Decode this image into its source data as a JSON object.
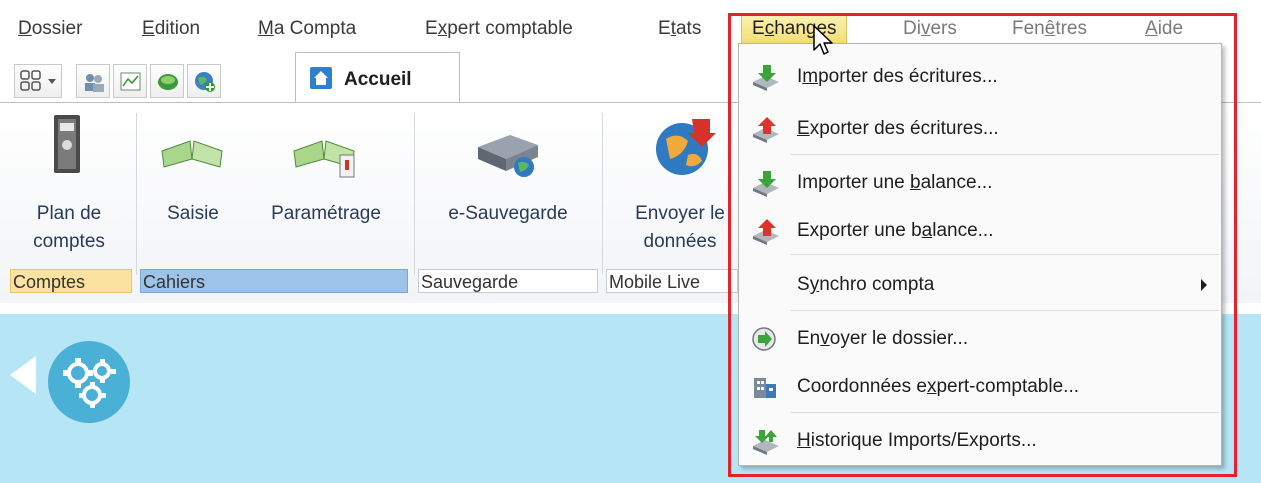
{
  "menubar": {
    "items": [
      {
        "label": "Dossier",
        "mnemonic": "D",
        "rest": "ossier"
      },
      {
        "label": "Edition",
        "mnemonic": "E",
        "rest": "dition"
      },
      {
        "label": "Ma Compta",
        "pre": "",
        "mnemonic": "M",
        "rest": "a Compta"
      },
      {
        "label": "Expert comptable",
        "pre": "E",
        "mnemonic": "x",
        "rest": "pert comptable"
      },
      {
        "label": "Etats",
        "pre": "E",
        "mnemonic": "t",
        "rest": "ats"
      },
      {
        "label": "Echanges",
        "pre": "E",
        "mnemonic": "c",
        "rest": "hanges"
      },
      {
        "label": "Divers",
        "pre": "Di",
        "mnemonic": "v",
        "rest": "ers"
      },
      {
        "label": "Fenêtres",
        "pre": "Fen",
        "mnemonic": "ê",
        "rest": "tres"
      },
      {
        "label": "Aide",
        "pre": "",
        "mnemonic": "A",
        "rest": "ide"
      }
    ]
  },
  "tabs": {
    "accueil": "Accueil"
  },
  "ribbon": {
    "buttons": {
      "plan_comptes_l1": "Plan de",
      "plan_comptes_l2": "comptes",
      "saisie": "Saisie",
      "parametrage": "Paramétrage",
      "e_sauvegarde": "e-Sauvegarde",
      "envoyer_l1": "Envoyer le",
      "envoyer_l2": "données"
    },
    "groups": {
      "comptes": "Comptes",
      "cahiers": "Cahiers",
      "sauvegarde": "Sauvegarde",
      "mobile": "Mobile Live"
    }
  },
  "dropdown": {
    "items": [
      {
        "pre": "I",
        "mnemonic": "m",
        "rest": "porter des écritures..."
      },
      {
        "pre": "",
        "mnemonic": "E",
        "rest": "xporter des écritures..."
      },
      {
        "pre": "Importer une ",
        "mnemonic": "b",
        "rest": "alance..."
      },
      {
        "pre": "Exporter une b",
        "mnemonic": "a",
        "rest": "lance..."
      },
      {
        "pre": "S",
        "mnemonic": "y",
        "rest": "nchro compta"
      },
      {
        "pre": "En",
        "mnemonic": "v",
        "rest": "oyer le dossier..."
      },
      {
        "pre": "Coordonnées e",
        "mnemonic": "x",
        "rest": "pert-comptable..."
      },
      {
        "pre": "",
        "mnemonic": "H",
        "rest": "istorique Imports/Exports..."
      }
    ]
  },
  "colors": {
    "active_menu_bg": "#f2dc71",
    "group_selected": "#fbe2a0",
    "group_cahiers": "#9ec3e8",
    "content_bg": "#b6e6f5",
    "highlight": "#e5232d"
  },
  "icons": {
    "import": "import-arrow-down-green-icon",
    "export": "export-arrow-up-red-icon",
    "send": "send-green-arrow-icon",
    "coords": "building-icon",
    "history": "history-import-export-icon"
  }
}
